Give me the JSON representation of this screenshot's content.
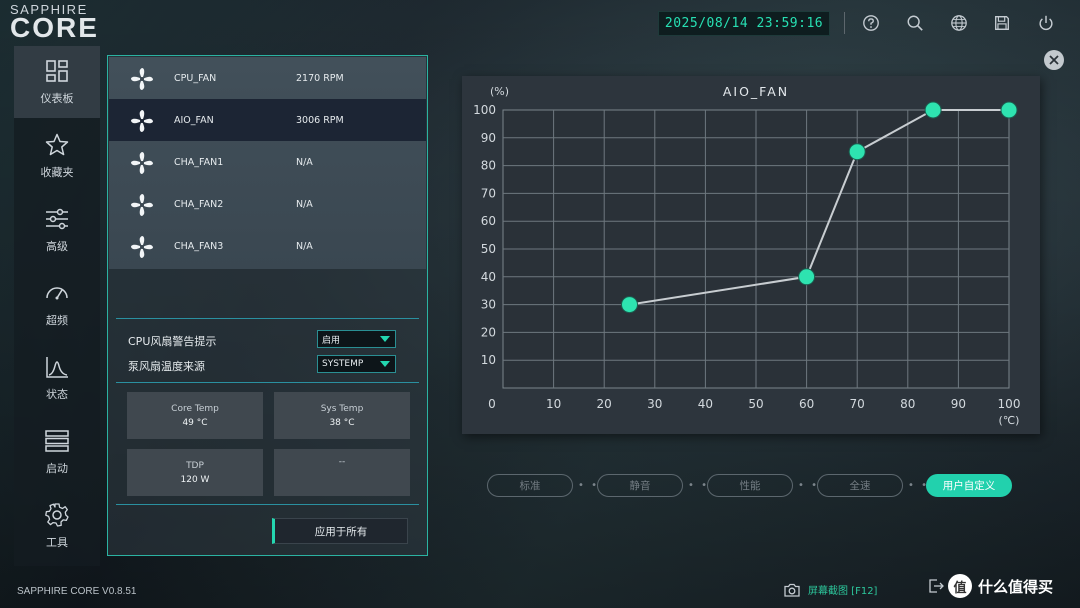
{
  "app": {
    "logo_top": "SAPPHIRE",
    "logo_main": "CORE",
    "datetime": "2025/08/14 23:59:16",
    "version": "SAPPHIRE CORE V0.8.51"
  },
  "header_icons": [
    "help-icon",
    "search-icon",
    "globe-icon",
    "save-icon",
    "power-icon"
  ],
  "nav": {
    "items": [
      {
        "label": "仪表板",
        "icon": "dashboard-icon",
        "active": true
      },
      {
        "label": "收藏夹",
        "icon": "star-icon",
        "active": false
      },
      {
        "label": "高级",
        "icon": "sliders-icon",
        "active": false
      },
      {
        "label": "超频",
        "icon": "gauge-icon",
        "active": false
      },
      {
        "label": "状态",
        "icon": "status-chart-icon",
        "active": false
      },
      {
        "label": "启动",
        "icon": "boot-list-icon",
        "active": false
      },
      {
        "label": "工具",
        "icon": "gear-icon",
        "active": false
      }
    ]
  },
  "fans": [
    {
      "name": "CPU_FAN",
      "speed": "2170 RPM",
      "selected": false
    },
    {
      "name": "AIO_FAN",
      "speed": "3006 RPM",
      "selected": true
    },
    {
      "name": "CHA_FAN1",
      "speed": "N/A",
      "selected": false
    },
    {
      "name": "CHA_FAN2",
      "speed": "N/A",
      "selected": false
    },
    {
      "name": "CHA_FAN3",
      "speed": "N/A",
      "selected": false
    }
  ],
  "settings": {
    "warning_label": "CPU风扇警告提示",
    "warning_value": "启用",
    "source_label": "泵风扇温度来源",
    "source_value": "SYSTEMP"
  },
  "stats": {
    "core_temp_label": "Core Temp",
    "core_temp_value": "49 °C",
    "sys_temp_label": "Sys Temp",
    "sys_temp_value": "38 °C",
    "tdp_label": "TDP",
    "tdp_value": "120 W",
    "empty_value": "--"
  },
  "apply_label": "应用于所有",
  "presets": [
    {
      "label": "标准",
      "active": false
    },
    {
      "label": "静音",
      "active": false
    },
    {
      "label": "性能",
      "active": false
    },
    {
      "label": "全速",
      "active": false
    },
    {
      "label": "用户自定义",
      "active": true
    }
  ],
  "footer": {
    "screenshot_label": "屏幕截图 [F12]",
    "watermark_text": "什么值得买",
    "watermark_logo": "值"
  },
  "colors": {
    "accent": "#22d1ad",
    "point": "#2ee3b0",
    "line": "#c8cdd1"
  },
  "chart_data": {
    "type": "line",
    "title": "AIO_FAN",
    "ylabel": "(%)",
    "xlabel": "(℃)",
    "xlim": [
      0,
      100
    ],
    "ylim": [
      0,
      100
    ],
    "x_ticks": [
      0,
      10,
      20,
      30,
      40,
      50,
      60,
      70,
      80,
      90,
      100
    ],
    "y_ticks": [
      10,
      20,
      30,
      40,
      50,
      60,
      70,
      80,
      90,
      100
    ],
    "grid": true,
    "points": [
      {
        "x": 25,
        "y": 30
      },
      {
        "x": 60,
        "y": 40
      },
      {
        "x": 70,
        "y": 85
      },
      {
        "x": 85,
        "y": 100
      },
      {
        "x": 100,
        "y": 100
      }
    ]
  }
}
